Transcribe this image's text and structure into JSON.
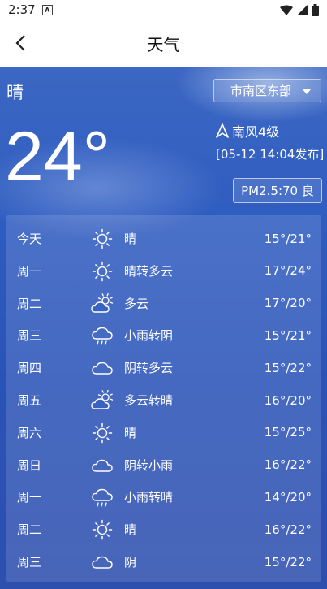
{
  "status": {
    "time": "2:37",
    "notif_icon": "A"
  },
  "header": {
    "title": "天气"
  },
  "current": {
    "condition": "晴",
    "temperature": "24°",
    "location": "市南区东部",
    "wind": "南风4级",
    "publish_time": "[05-12 14:04发布]",
    "aqi": "PM2.5:70 良"
  },
  "forecast": [
    {
      "day": "今天",
      "icon": "sunny-icon",
      "desc": "晴",
      "range": "15°/21°"
    },
    {
      "day": "周一",
      "icon": "sunny-icon",
      "desc": "晴转多云",
      "range": "17°/24°"
    },
    {
      "day": "周二",
      "icon": "partly-cloudy-icon",
      "desc": "多云",
      "range": "17°/20°"
    },
    {
      "day": "周三",
      "icon": "light-rain-icon",
      "desc": "小雨转阴",
      "range": "15°/21°"
    },
    {
      "day": "周四",
      "icon": "cloudy-icon",
      "desc": "阴转多云",
      "range": "15°/22°"
    },
    {
      "day": "周五",
      "icon": "partly-cloudy-icon",
      "desc": "多云转晴",
      "range": "16°/20°"
    },
    {
      "day": "周六",
      "icon": "sunny-icon",
      "desc": "晴",
      "range": "15°/25°"
    },
    {
      "day": "周日",
      "icon": "cloudy-icon",
      "desc": "阴转小雨",
      "range": "16°/22°"
    },
    {
      "day": "周一",
      "icon": "light-rain-icon",
      "desc": "小雨转晴",
      "range": "14°/20°"
    },
    {
      "day": "周二",
      "icon": "sunny-icon",
      "desc": "晴",
      "range": "16°/22°"
    },
    {
      "day": "周三",
      "icon": "cloudy-icon",
      "desc": "阴",
      "range": "15°/22°"
    }
  ]
}
